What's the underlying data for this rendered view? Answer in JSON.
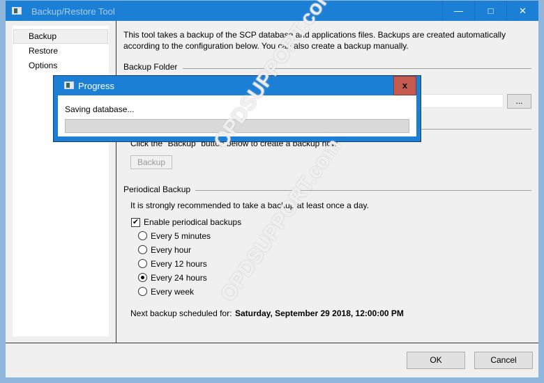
{
  "window": {
    "title": "Backup/Restore Tool",
    "minimize_icon": "minimize-icon",
    "maximize_icon": "maximize-icon",
    "close_icon": "close-icon"
  },
  "sidebar": {
    "items": [
      {
        "label": "Backup",
        "selected": true
      },
      {
        "label": "Restore"
      },
      {
        "label": "Options"
      }
    ]
  },
  "main": {
    "intro_line1": "This tool takes a backup of the SCP database and applications files. Backups are created automatically",
    "intro_line2": "according to the configuration below. You can also create a backup manually.",
    "backup_folder": {
      "header": "Backup Folder",
      "value": "",
      "browse_label": "..."
    },
    "manual": {
      "instruction": "Click the \"Backup\" button below to create a backup now.",
      "button_label": "Backup"
    },
    "periodical": {
      "header": "Periodical Backup",
      "recommendation": "It is strongly recommended to take a backup at least once a day.",
      "enable_label": "Enable periodical backups",
      "enabled": true,
      "options": [
        {
          "label": "Every 5 minutes",
          "selected": false
        },
        {
          "label": "Every hour",
          "selected": false
        },
        {
          "label": "Every 12 hours",
          "selected": false
        },
        {
          "label": "Every 24 hours",
          "selected": true
        },
        {
          "label": "Every week",
          "selected": false
        }
      ],
      "next_label": "Next backup scheduled for:",
      "next_value": "Saturday, September 29 2018, 12:00:00 PM"
    }
  },
  "footer": {
    "ok_label": "OK",
    "cancel_label": "Cancel"
  },
  "progress_dialog": {
    "title": "Progress",
    "status": "Saving database...",
    "close_label": "x",
    "progress": 0
  },
  "watermark": "OPDSUPPORT.com",
  "colors": {
    "titlebar": "#1c7fd6",
    "close_button": "#c45a50"
  }
}
